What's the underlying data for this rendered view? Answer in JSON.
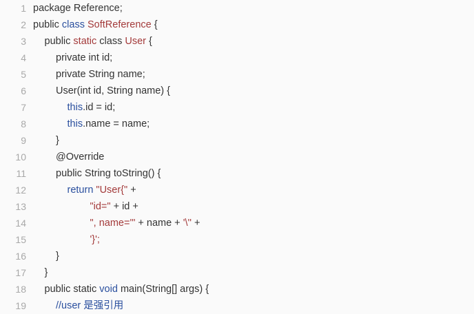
{
  "colors": {
    "background": "#fafafa",
    "line_number": "#a8a8a8",
    "plain": "#333333",
    "keyword": "#2a4f9e",
    "class_or_string": "#a33a3a",
    "comment": "#2a4f9e"
  },
  "lines": [
    {
      "num": "1",
      "indent": 0,
      "tokens": [
        {
          "t": "package Reference;",
          "k": "plain"
        }
      ]
    },
    {
      "num": "2",
      "indent": 0,
      "tokens": [
        {
          "t": "public ",
          "k": "plain"
        },
        {
          "t": "class ",
          "k": "kw"
        },
        {
          "t": "SoftReference",
          "k": "cls"
        },
        {
          "t": " {",
          "k": "plain"
        }
      ]
    },
    {
      "num": "3",
      "indent": 1,
      "tokens": [
        {
          "t": "public ",
          "k": "plain"
        },
        {
          "t": "static ",
          "k": "cls"
        },
        {
          "t": "class ",
          "k": "plain"
        },
        {
          "t": "User",
          "k": "cls"
        },
        {
          "t": " {",
          "k": "plain"
        }
      ]
    },
    {
      "num": "4",
      "indent": 2,
      "tokens": [
        {
          "t": "private int id;",
          "k": "plain"
        }
      ]
    },
    {
      "num": "5",
      "indent": 2,
      "tokens": [
        {
          "t": "private String name;",
          "k": "plain"
        }
      ]
    },
    {
      "num": "6",
      "indent": 2,
      "tokens": [
        {
          "t": "User(int id, String name) {",
          "k": "plain"
        }
      ]
    },
    {
      "num": "7",
      "indent": 3,
      "tokens": [
        {
          "t": "this",
          "k": "kw"
        },
        {
          "t": ".id = id;",
          "k": "plain"
        }
      ]
    },
    {
      "num": "8",
      "indent": 3,
      "tokens": [
        {
          "t": "this",
          "k": "kw"
        },
        {
          "t": ".name = name;",
          "k": "plain"
        }
      ]
    },
    {
      "num": "9",
      "indent": 2,
      "tokens": [
        {
          "t": "}",
          "k": "plain"
        }
      ]
    },
    {
      "num": "10",
      "indent": 2,
      "tokens": [
        {
          "t": "@Override",
          "k": "plain"
        }
      ]
    },
    {
      "num": "11",
      "indent": 2,
      "tokens": [
        {
          "t": "public String toString() {",
          "k": "plain"
        }
      ]
    },
    {
      "num": "12",
      "indent": 3,
      "tokens": [
        {
          "t": "return ",
          "k": "kw"
        },
        {
          "t": "\"User{\"",
          "k": "str"
        },
        {
          "t": " +",
          "k": "plain"
        }
      ]
    },
    {
      "num": "13",
      "indent": 5,
      "tokens": [
        {
          "t": "\"id=\"",
          "k": "str"
        },
        {
          "t": " + id +",
          "k": "plain"
        }
      ]
    },
    {
      "num": "14",
      "indent": 5,
      "tokens": [
        {
          "t": "\", name='\"",
          "k": "str"
        },
        {
          "t": " + name + ",
          "k": "plain"
        },
        {
          "t": "'\\''",
          "k": "str"
        },
        {
          "t": " +",
          "k": "plain"
        }
      ]
    },
    {
      "num": "15",
      "indent": 5,
      "tokens": [
        {
          "t": "'}';",
          "k": "str"
        }
      ]
    },
    {
      "num": "16",
      "indent": 2,
      "tokens": [
        {
          "t": "}",
          "k": "plain"
        }
      ]
    },
    {
      "num": "17",
      "indent": 1,
      "tokens": [
        {
          "t": "}",
          "k": "plain"
        }
      ]
    },
    {
      "num": "18",
      "indent": 1,
      "tokens": [
        {
          "t": "public static ",
          "k": "plain"
        },
        {
          "t": "void ",
          "k": "kw"
        },
        {
          "t": "main(String[] args) {",
          "k": "plain"
        }
      ]
    },
    {
      "num": "19",
      "indent": 2,
      "tokens": [
        {
          "t": "//user 是强引用",
          "k": "cmt"
        }
      ]
    }
  ]
}
